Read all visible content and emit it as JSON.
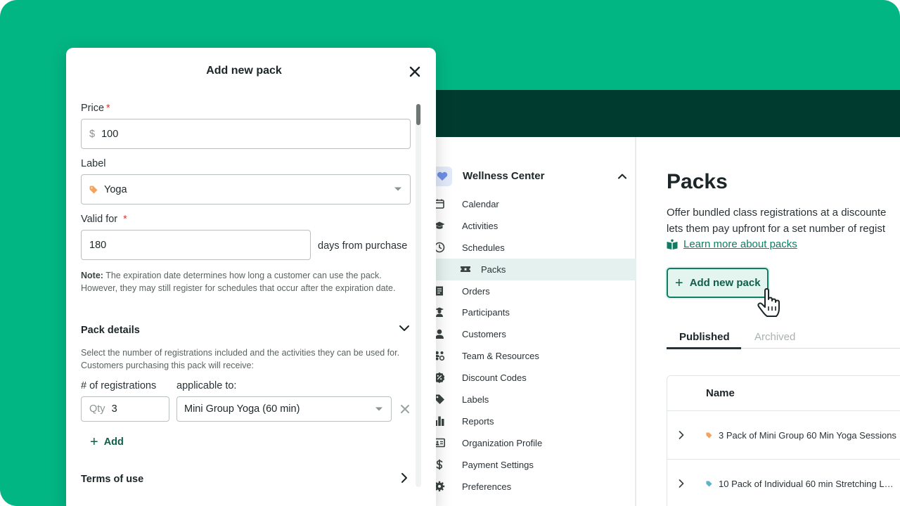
{
  "modal": {
    "title": "Add new pack",
    "price": {
      "label": "Price",
      "required": "*",
      "prefix": "$",
      "value": "100"
    },
    "label_field": {
      "label": "Label",
      "value": "Yoga",
      "tag_color": "#f3a35b"
    },
    "valid_for": {
      "label": "Valid for",
      "required": "*",
      "value": "180",
      "suffix": "days from purchase"
    },
    "note": {
      "bold": "Note:",
      "text": " The expiration date determines how long a customer can use the pack. However, they may still register for schedules that occur after the expiration date."
    },
    "pack_details": {
      "title": "Pack details",
      "description": "Select the number of registrations included and the activities they can be used for. Customers purchasing this pack will receive:",
      "registrations_label": "# of registrations",
      "applicable_label": "applicable to:",
      "qty_placeholder": "Qty",
      "qty_value": "3",
      "activity_value": "Mini Group Yoga (60 min)",
      "add_label": "Add"
    },
    "terms_title": "Terms of use"
  },
  "sidebar": {
    "org_name": "Wellness Center",
    "items": [
      {
        "label": "Calendar",
        "icon": "calendar-icon"
      },
      {
        "label": "Activities",
        "icon": "graduation-cap-icon"
      },
      {
        "label": "Schedules",
        "icon": "clock-icon"
      },
      {
        "label": "Packs",
        "icon": "ticket-icon",
        "active": true
      },
      {
        "label": "Orders",
        "icon": "receipt-icon"
      },
      {
        "label": "Participants",
        "icon": "student-icon"
      },
      {
        "label": "Customers",
        "icon": "person-icon"
      },
      {
        "label": "Team & Resources",
        "icon": "team-icon"
      },
      {
        "label": "Discount Codes",
        "icon": "percent-icon"
      },
      {
        "label": "Labels",
        "icon": "tag-icon"
      },
      {
        "label": "Reports",
        "icon": "bar-chart-icon"
      },
      {
        "label": "Organization Profile",
        "icon": "id-card-icon"
      },
      {
        "label": "Payment Settings",
        "icon": "dollar-icon"
      },
      {
        "label": "Preferences",
        "icon": "gear-icon"
      }
    ]
  },
  "main": {
    "title": "Packs",
    "description_line1": "Offer bundled class registrations at a discounte",
    "description_line2": "lets them pay upfront for a set number of regist",
    "learn_more": "Learn more about packs",
    "add_button": "Add new pack",
    "tabs": {
      "published": "Published",
      "archived": "Archived"
    },
    "table": {
      "header": "Name",
      "rows": [
        {
          "name": "3 Pack of Mini Group 60 Min Yoga Sessions",
          "tag_color": "#f3a35b"
        },
        {
          "name": "10 Pack of Individual 60 min Stretching L…",
          "tag_color": "#5fb2c7"
        }
      ]
    }
  },
  "colors": {
    "brand_green": "#02b683",
    "dark_green": "#003b30",
    "accent": "#0f7d63"
  }
}
